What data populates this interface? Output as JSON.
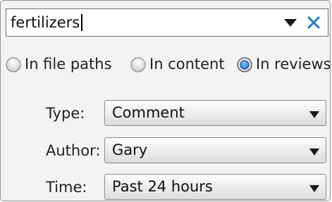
{
  "search": {
    "value": "fertilizers",
    "dropdown_icon": "triangle-down-icon",
    "clear_icon": "close-x-icon",
    "clear_color": "#1f78d6"
  },
  "scope": {
    "options": [
      {
        "label": "In file paths",
        "selected": false
      },
      {
        "label": "In content",
        "selected": false
      },
      {
        "label": "In reviews",
        "selected": true
      }
    ],
    "selected_color": "#1e78d8"
  },
  "filters": {
    "type": {
      "label": "Type:",
      "value": "Comment"
    },
    "author": {
      "label": "Author:",
      "value": "Gary"
    },
    "time": {
      "label": "Time:",
      "value": "Past 24 hours"
    }
  }
}
